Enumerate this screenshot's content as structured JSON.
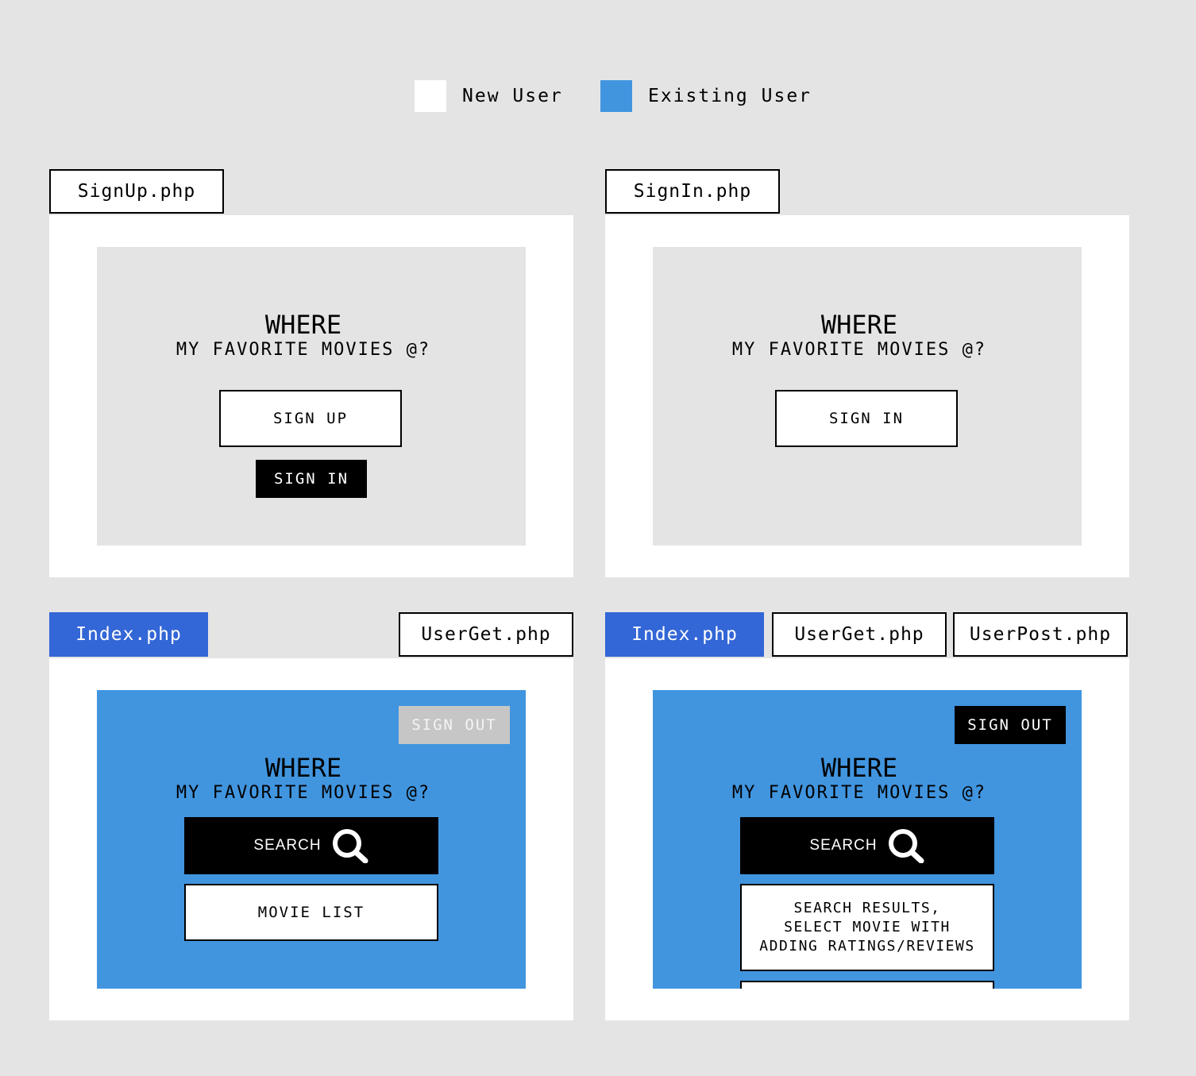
{
  "legend": {
    "new_user": {
      "label": "New User",
      "color": "#ffffff"
    },
    "existing_user": {
      "label": "Existing User",
      "color": "#4195df"
    }
  },
  "app": {
    "title_main": "WHERE",
    "title_sub": "MY FAVORITE MOVIES @?"
  },
  "panels": {
    "signup": {
      "tab": "SignUp.php",
      "primary_button": "SIGN UP",
      "secondary_button": "SIGN IN"
    },
    "signin": {
      "tab": "SignIn.php",
      "primary_button": "SIGN IN"
    },
    "index_new": {
      "tab_active": "Index.php",
      "tab_other": "UserGet.php",
      "sign_out": "SIGN OUT",
      "search": "SEARCH",
      "movie_list": "MOVIE LIST"
    },
    "index_existing": {
      "tab_active": "Index.php",
      "tab_get": "UserGet.php",
      "tab_post": "UserPost.php",
      "sign_out": "SIGN OUT",
      "search": "SEARCH",
      "results": "SEARCH RESULTS,\nSELECT MOVIE WITH\nADDING RATINGS/REVIEWS"
    }
  },
  "colors": {
    "background": "#e4e4e4",
    "existing_user_blue": "#4195df",
    "active_tab_blue": "#3366d6",
    "disabled_gray": "#c6c6c6"
  },
  "icons": [
    "search-icon"
  ]
}
